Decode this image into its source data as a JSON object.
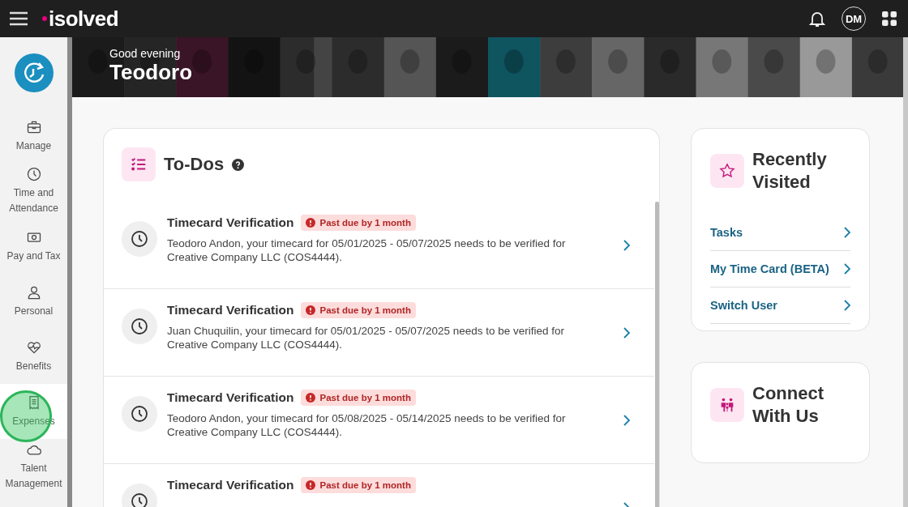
{
  "header": {
    "logo": "isolved",
    "avatar": "DM"
  },
  "banner": {
    "greeting": "Good evening",
    "name": "Teodoro"
  },
  "sidebar": {
    "items": [
      {
        "label": "Manage",
        "kind": "briefcase",
        "selected": false
      },
      {
        "label": "Time and Attendance",
        "kind": "clock",
        "selected": false
      },
      {
        "label": "Pay and Tax",
        "kind": "money",
        "selected": false
      },
      {
        "label": "Personal",
        "kind": "person",
        "selected": false
      },
      {
        "label": "Benefits",
        "kind": "heart",
        "selected": false
      },
      {
        "label": "Expenses",
        "kind": "receipt",
        "selected": true
      },
      {
        "label": "Talent Management",
        "kind": "cloud",
        "selected": false
      }
    ]
  },
  "todos": {
    "title": "To-Dos",
    "items": [
      {
        "title": "Timecard Verification",
        "badge": "Past due by 1 month",
        "text": "Teodoro Andon, your timecard for 05/01/2025 - 05/07/2025 needs to be verified for Creative Company LLC (COS4444)."
      },
      {
        "title": "Timecard Verification",
        "badge": "Past due by 1 month",
        "text": "Juan Chuquilin, your timecard for 05/01/2025 - 05/07/2025 needs to be verified for Creative Company LLC (COS4444)."
      },
      {
        "title": "Timecard Verification",
        "badge": "Past due by 1 month",
        "text": "Teodoro Andon, your timecard for 05/08/2025 - 05/14/2025 needs to be verified for Creative Company LLC (COS4444)."
      },
      {
        "title": "Timecard Verification",
        "badge": "Past due by 1 month"
      }
    ]
  },
  "recently_visited": {
    "title": "Recently Visited",
    "links": [
      "Tasks",
      "My Time Card (BETA)",
      "Switch User"
    ]
  },
  "connect": {
    "title": "Connect With Us"
  }
}
